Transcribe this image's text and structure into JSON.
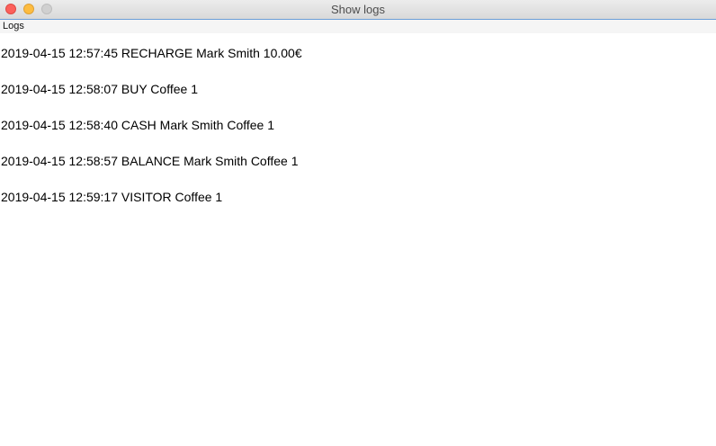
{
  "window": {
    "title": "Show logs",
    "controls": {
      "close": "close-icon",
      "minimize": "minimize-icon",
      "maximize": "maximize-icon"
    }
  },
  "panel": {
    "label": "Logs"
  },
  "logs": [
    "2019-04-15 12:57:45 RECHARGE Mark Smith 10.00€",
    "2019-04-15 12:58:07 BUY Coffee 1",
    "2019-04-15 12:58:40 CASH Mark Smith Coffee 1",
    "2019-04-15 12:58:57 BALANCE Mark Smith Coffee 1",
    "2019-04-15 12:59:17 VISITOR Coffee 1"
  ],
  "colors": {
    "close": "#fc605b",
    "minimize": "#fdbc40",
    "maximize": "#d0d0d0",
    "accent": "#6b9fd8"
  }
}
